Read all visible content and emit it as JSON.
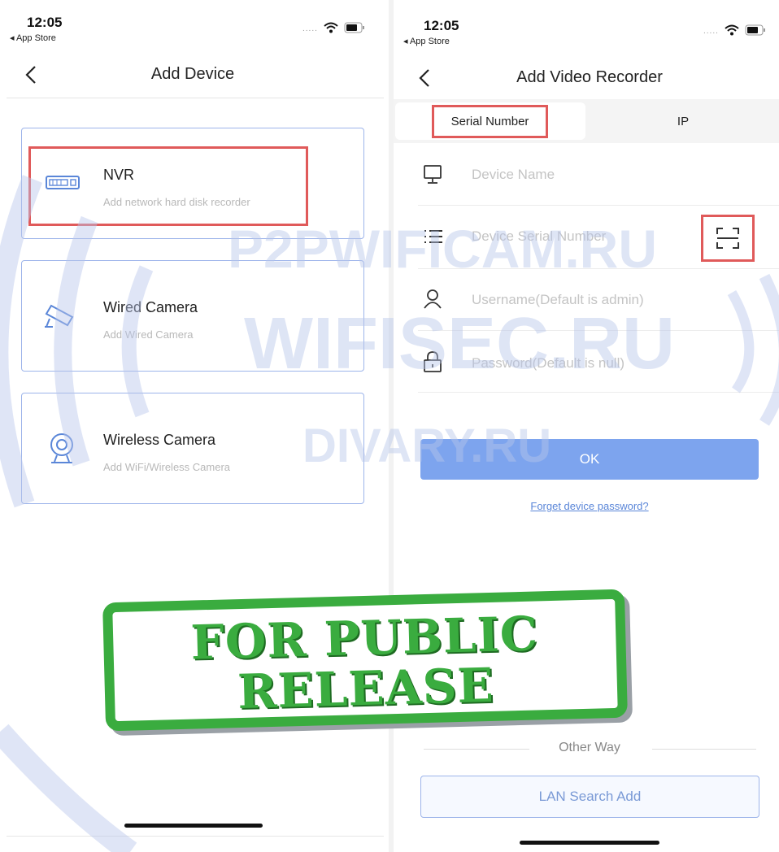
{
  "left": {
    "status": {
      "time": "12:05",
      "back": "◂ App Store"
    },
    "nav": {
      "title": "Add Device"
    },
    "options": [
      {
        "title": "NVR",
        "subtitle": "Add network hard disk recorder",
        "icon": "nvr-icon"
      },
      {
        "title": "Wired Camera",
        "subtitle": "Add Wired Camera",
        "icon": "wired-camera-icon"
      },
      {
        "title": "Wireless Camera",
        "subtitle": "Add WiFi/Wireless Camera",
        "icon": "wireless-camera-icon"
      }
    ]
  },
  "right": {
    "status": {
      "time": "12:05",
      "back": "◂ App Store"
    },
    "nav": {
      "title": "Add Video Recorder"
    },
    "tabs": [
      {
        "label": "Serial Number"
      },
      {
        "label": "IP"
      }
    ],
    "fields": [
      {
        "placeholder": "Device Name",
        "icon": "monitor-icon"
      },
      {
        "placeholder": "Device Serial Number",
        "icon": "list-icon"
      },
      {
        "placeholder": "Username(Default is admin)",
        "icon": "user-icon"
      },
      {
        "placeholder": "Password(Default is null)",
        "icon": "lock-icon"
      }
    ],
    "ok_label": "OK",
    "forgot_label": "Forget device password?",
    "other_way_label": "Other Way",
    "lan_label": "LAN Search Add"
  },
  "watermarks": {
    "line1": "P2PWIFICAM.RU",
    "line2": "WIFISEC.RU",
    "line3": "DIVARY.RU"
  },
  "stamp": {
    "line1": "FOR PUBLIC",
    "line2": "RELEASE"
  },
  "colors": {
    "accent": "#7da4ee",
    "highlight": "#e05a5a",
    "stamp": "#3aac3f",
    "card_border": "#9db4ea"
  }
}
